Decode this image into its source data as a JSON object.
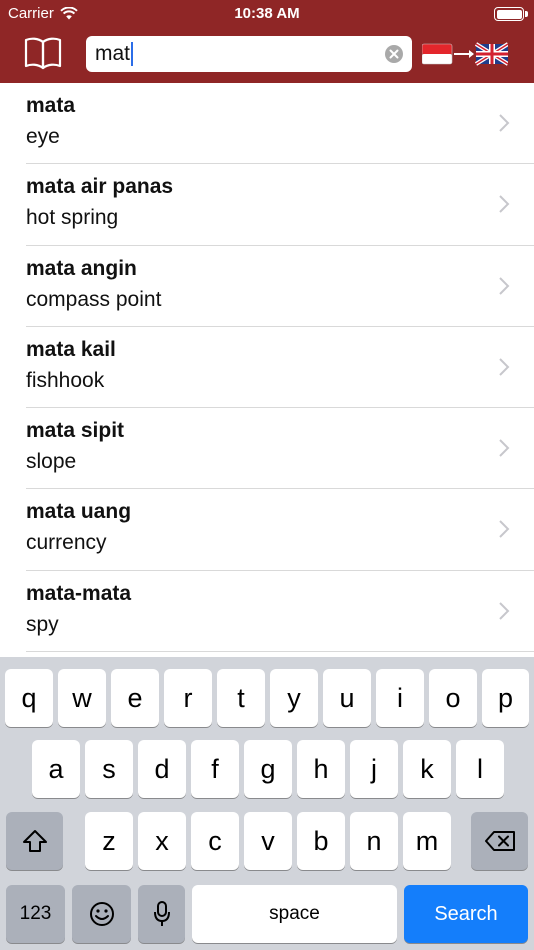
{
  "status_bar": {
    "carrier": "Carrier",
    "time": "10:38 AM",
    "battery_level": 1.0
  },
  "nav": {
    "search_value": "mat",
    "lang_from": "Indonesian",
    "lang_to": "English"
  },
  "results": [
    {
      "word": "mata",
      "translation": "eye"
    },
    {
      "word": "mata air panas",
      "translation": "hot spring"
    },
    {
      "word": "mata angin",
      "translation": "compass point"
    },
    {
      "word": "mata kail",
      "translation": "fishhook"
    },
    {
      "word": "mata sipit",
      "translation": "slope"
    },
    {
      "word": "mata uang",
      "translation": "currency"
    },
    {
      "word": "mata-mata",
      "translation": "spy"
    }
  ],
  "keyboard": {
    "row1": [
      "q",
      "w",
      "e",
      "r",
      "t",
      "y",
      "u",
      "i",
      "o",
      "p"
    ],
    "row2": [
      "a",
      "s",
      "d",
      "f",
      "g",
      "h",
      "j",
      "k",
      "l"
    ],
    "row3": [
      "z",
      "x",
      "c",
      "v",
      "b",
      "n",
      "m"
    ],
    "numbers_label": "123",
    "space_label": "space",
    "search_label": "Search"
  },
  "colors": {
    "brand": "#8f2626",
    "accent": "#147efb"
  }
}
